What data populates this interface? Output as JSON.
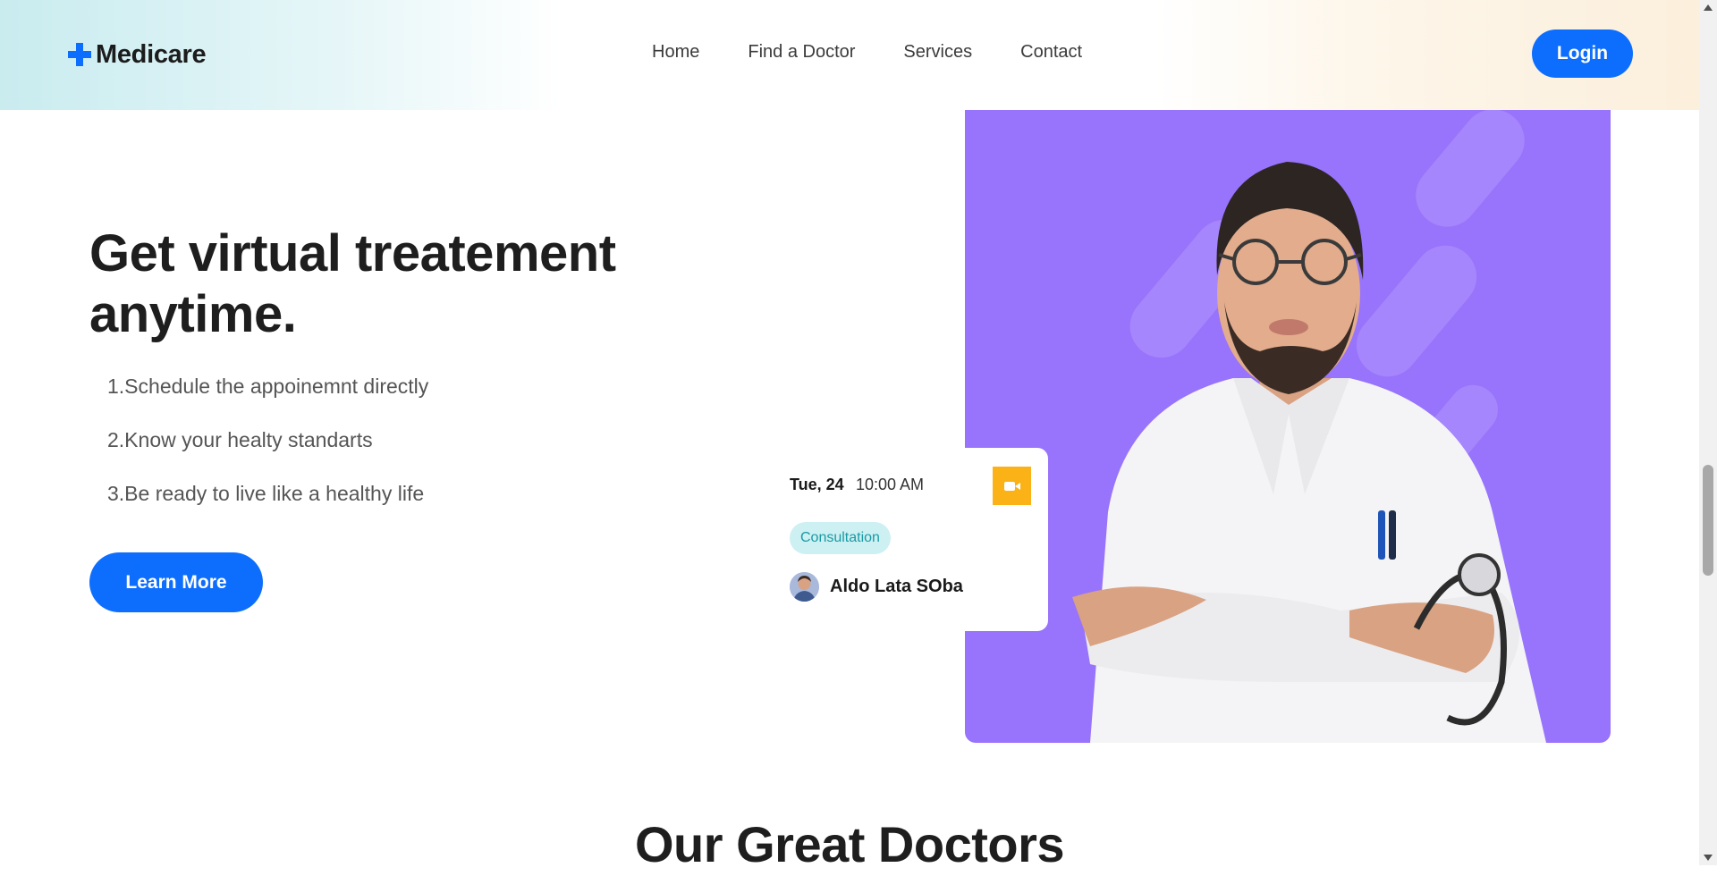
{
  "brand": {
    "name": "Medicare",
    "accent": "#0d6efd"
  },
  "nav": {
    "items": [
      "Home",
      "Find a Doctor",
      "Services",
      "Contact"
    ],
    "login_label": "Login"
  },
  "hero": {
    "title": "Get virtual treatement anytime.",
    "steps": [
      "1.Schedule the appoinemnt directly",
      "2.Know your healty standarts",
      "3.Be ready to live like a healthy life"
    ],
    "cta_label": "Learn More",
    "image_bg": "#9873fb"
  },
  "appointment": {
    "date": "Tue, 24",
    "time": "10:00 AM",
    "tag": "Consultation",
    "name": "Aldo Lata SOba",
    "icon": "video-camera-icon"
  },
  "section": {
    "title": "Our Great Doctors"
  }
}
